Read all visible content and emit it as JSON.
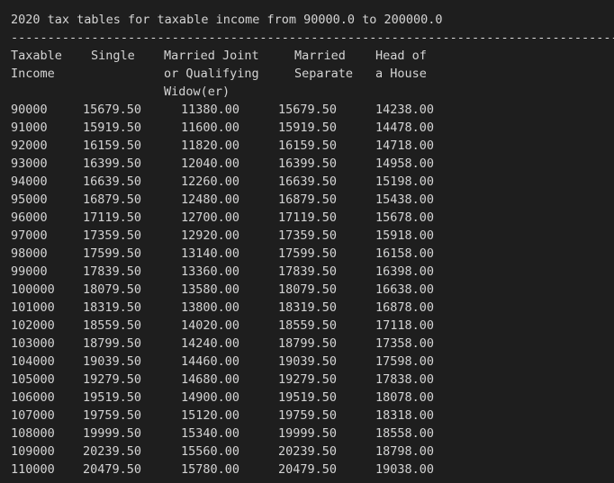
{
  "title": "2020 tax tables for taxable income from 90000.0 to 200000.0",
  "divider": "-----------------------------------------------------------------------------------------------",
  "headers": [
    "Taxable\nIncome",
    "Single",
    "Married Joint\nor Qualifying\nWidow(er)",
    "Married\nSeparate",
    "Head of\na House"
  ],
  "rows": [
    [
      "90000",
      "15679.50",
      "11380.00",
      "15679.50",
      "14238.00"
    ],
    [
      "91000",
      "15919.50",
      "11600.00",
      "15919.50",
      "14478.00"
    ],
    [
      "92000",
      "16159.50",
      "11820.00",
      "16159.50",
      "14718.00"
    ],
    [
      "93000",
      "16399.50",
      "12040.00",
      "16399.50",
      "14958.00"
    ],
    [
      "94000",
      "16639.50",
      "12260.00",
      "16639.50",
      "15198.00"
    ],
    [
      "95000",
      "16879.50",
      "12480.00",
      "16879.50",
      "15438.00"
    ],
    [
      "96000",
      "17119.50",
      "12700.00",
      "17119.50",
      "15678.00"
    ],
    [
      "97000",
      "17359.50",
      "12920.00",
      "17359.50",
      "15918.00"
    ],
    [
      "98000",
      "17599.50",
      "13140.00",
      "17599.50",
      "16158.00"
    ],
    [
      "99000",
      "17839.50",
      "13360.00",
      "17839.50",
      "16398.00"
    ],
    [
      "100000",
      "18079.50",
      "13580.00",
      "18079.50",
      "16638.00"
    ],
    [
      "101000",
      "18319.50",
      "13800.00",
      "18319.50",
      "16878.00"
    ],
    [
      "102000",
      "18559.50",
      "14020.00",
      "18559.50",
      "17118.00"
    ],
    [
      "103000",
      "18799.50",
      "14240.00",
      "18799.50",
      "17358.00"
    ],
    [
      "104000",
      "19039.50",
      "14460.00",
      "19039.50",
      "17598.00"
    ],
    [
      "105000",
      "19279.50",
      "14680.00",
      "19279.50",
      "17838.00"
    ],
    [
      "106000",
      "19519.50",
      "14900.00",
      "19519.50",
      "18078.00"
    ],
    [
      "107000",
      "19759.50",
      "15120.00",
      "19759.50",
      "18318.00"
    ],
    [
      "108000",
      "19999.50",
      "15340.00",
      "19999.50",
      "18558.00"
    ],
    [
      "109000",
      "20239.50",
      "15560.00",
      "20239.50",
      "18798.00"
    ],
    [
      "110000",
      "20479.50",
      "15780.00",
      "20479.50",
      "19038.00"
    ]
  ]
}
